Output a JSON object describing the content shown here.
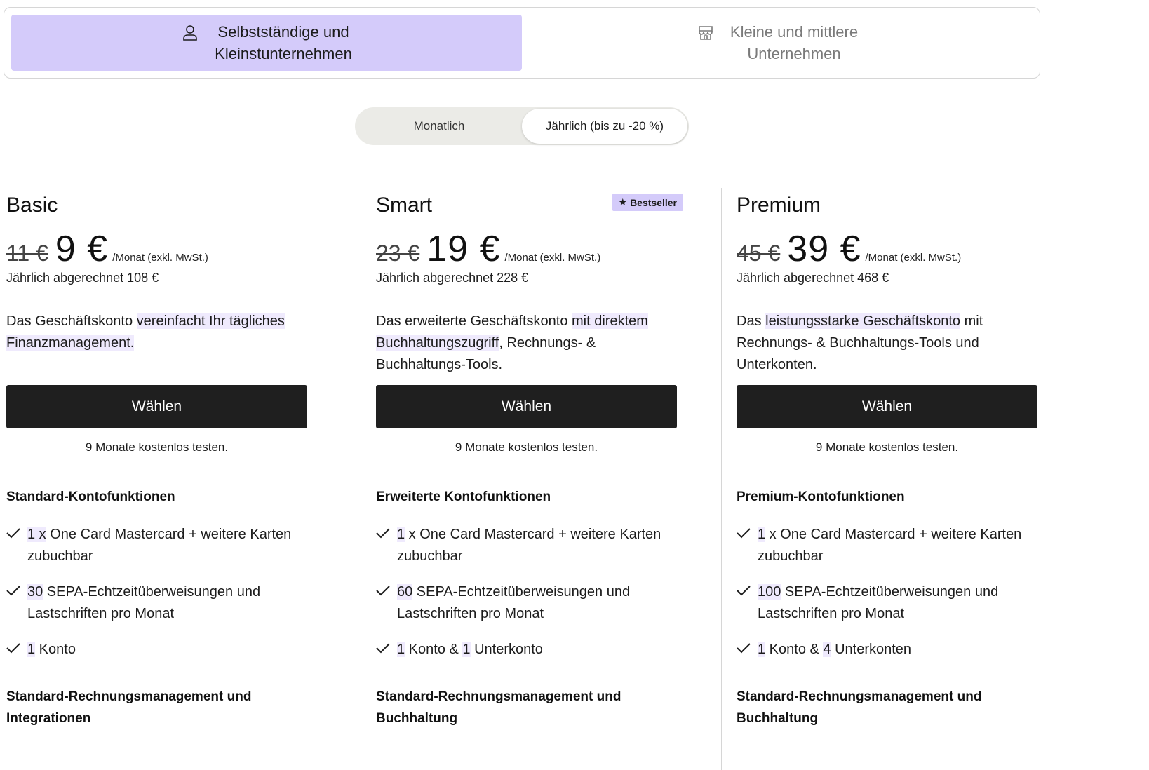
{
  "segments": {
    "self_employed": {
      "line1": "Selbstständige und",
      "line2": "Kleinstunternehmen",
      "icon": "user-icon"
    },
    "sme": {
      "line1": "Kleine und mittlere",
      "line2": "Unternehmen",
      "icon": "store-icon"
    }
  },
  "billing": {
    "monthly": "Monatlich",
    "yearly": "Jährlich (bis zu -20 %)",
    "selected": "yearly"
  },
  "colors": {
    "accent": "#d4cbfa",
    "highlight": "#efeafd",
    "button": "#1f1f1f"
  },
  "plans": [
    {
      "name": "Basic",
      "old_price": "11 €",
      "price": "9 €",
      "per": "/Monat (exkl. MwSt.)",
      "billed": "Jährlich abgerechnet 108 €",
      "desc_a": "Das Geschäftskonto ",
      "desc_b": "vereinfacht Ihr tägliches Finanzmanagement.",
      "desc_c": "",
      "button": "Wählen",
      "trial": "9 Monate kostenlos testen.",
      "features_title": "Standard-Kontofunktionen",
      "f1_n": "1 x",
      "f1_t": " One Card Mastercard + weitere Karten zubuchbar",
      "f2_n": "30",
      "f2_t": " SEPA-Echtzeitüberweisungen und Lastschriften pro Monat",
      "f3_n": "1",
      "f3_t": " Konto",
      "f3_m": "",
      "f3_n2": "",
      "f3_t2": "",
      "section2_title": "Standard-Rechnungsmanagement und Integrationen"
    },
    {
      "name": "Smart",
      "badge": "Bestseller",
      "old_price": "23 €",
      "price": "19 €",
      "per": "/Monat (exkl. MwSt.)",
      "billed": "Jährlich abgerechnet 228 €",
      "desc_a": "Das erweiterte Geschäftskonto ",
      "desc_b": "mit direktem Buchhaltungszugriff",
      "desc_c": ", Rechnungs- & Buchhaltungs-Tools.",
      "button": "Wählen",
      "trial": "9 Monate kostenlos testen.",
      "features_title": "Erweiterte Kontofunktionen",
      "f1_n": "1",
      "f1_t": " x One Card Mastercard + weitere Karten zubuchbar",
      "f2_n": "60",
      "f2_t": " SEPA-Echtzeitüberweisungen und Lastschriften pro Monat",
      "f3_n": "1",
      "f3_t": " Konto & ",
      "f3_m": "",
      "f3_n2": "1",
      "f3_t2": " Unterkonto",
      "section2_title": "Standard-Rechnungsmanagement und Buchhaltung"
    },
    {
      "name": "Premium",
      "old_price": "45 €",
      "price": "39 €",
      "per": "/Monat (exkl. MwSt.)",
      "billed": "Jährlich abgerechnet 468 €",
      "desc_a": "Das ",
      "desc_b": "leistungsstarke Geschäftskonto",
      "desc_c": " mit Rechnungs- & Buchhaltungs-Tools und Unterkonten.",
      "button": "Wählen",
      "trial": "9 Monate kostenlos testen.",
      "features_title": "Premium-Kontofunktionen",
      "f1_n": "1",
      "f1_t": " x One Card Mastercard + weitere Karten zubuchbar",
      "f2_n": "100",
      "f2_t": " SEPA-Echtzeitüberweisungen und Lastschriften pro Monat",
      "f3_n": "1",
      "f3_t": " Konto & ",
      "f3_m": "",
      "f3_n2": "4",
      "f3_t2": " Unterkonten",
      "section2_title": "Standard-Rechnungsmanagement und Buchhaltung"
    }
  ]
}
